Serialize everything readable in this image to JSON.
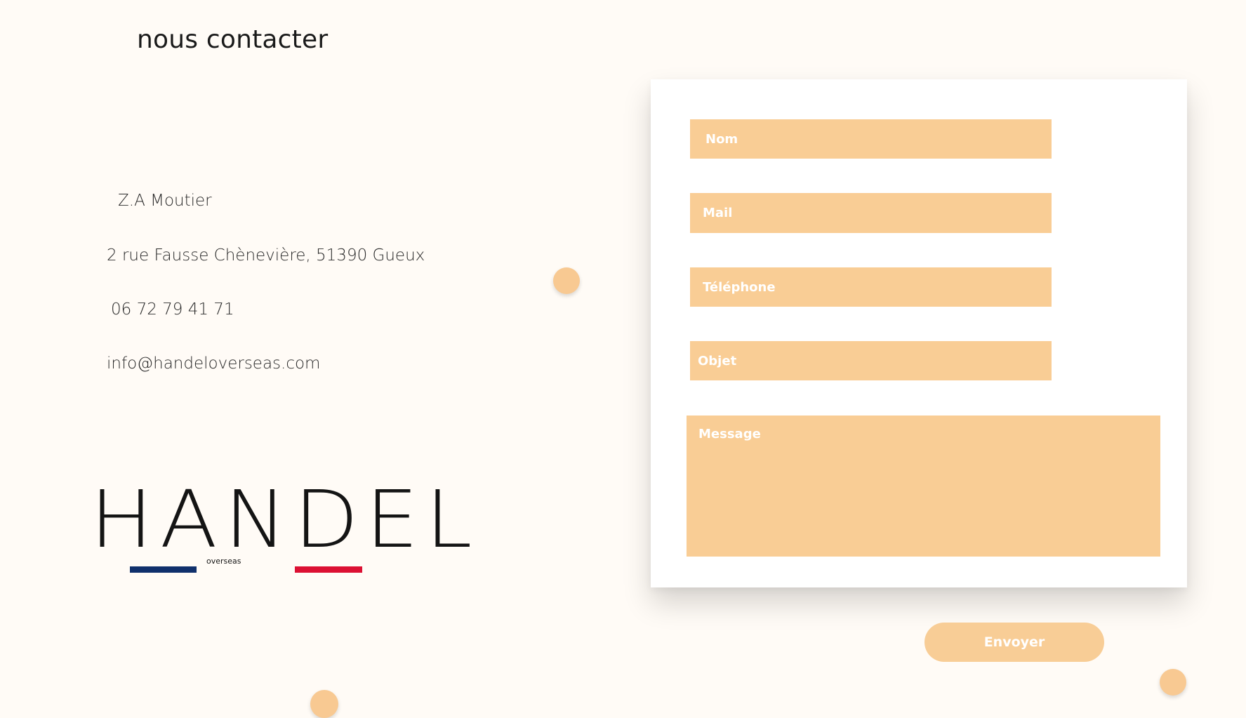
{
  "header": {
    "title": "nous contacter"
  },
  "contact": {
    "address_line1": "Z.A Moutier",
    "address_line2": "2 rue Fausse Chènevière, 51390 Gueux",
    "phone": "06 72 79 41 71",
    "email": "info@handeloverseas.com"
  },
  "logo": {
    "wordmark": "HANDEL",
    "subtitle": "overseas",
    "stripe_left_color": "#10306c",
    "stripe_right_color": "#dc1033"
  },
  "form": {
    "name_placeholder": "Nom",
    "mail_placeholder": "Mail",
    "phone_placeholder": "Téléphone",
    "subject_placeholder": "Objet",
    "message_placeholder": "Message",
    "submit_label": "Envoyer"
  },
  "colors": {
    "background": "#fffbf6",
    "accent": "#f9cd95",
    "card": "#ffffff",
    "text": "#1a1a1a"
  }
}
